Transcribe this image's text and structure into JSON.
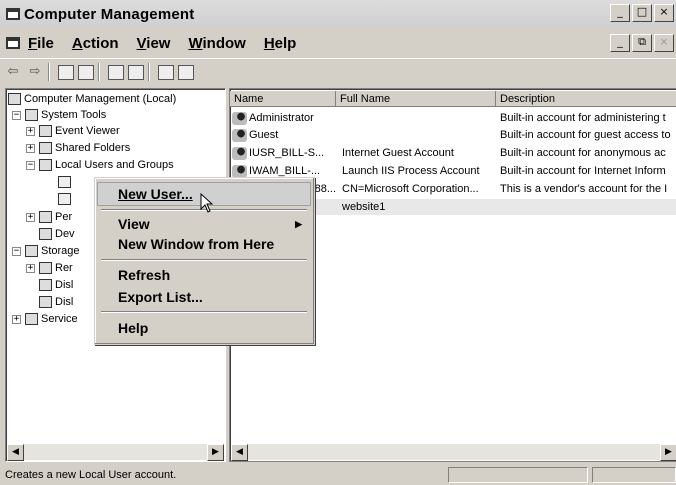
{
  "window": {
    "title": "Computer Management",
    "buttons": [
      "_",
      "□",
      "×"
    ],
    "mdi_buttons": [
      "_",
      "⧉",
      "×"
    ]
  },
  "menubar": {
    "items": [
      {
        "u": "F",
        "rest": "ile"
      },
      {
        "u": "A",
        "rest": "ction"
      },
      {
        "u": "V",
        "rest": "iew"
      },
      {
        "u": "W",
        "rest": "indow"
      },
      {
        "u": "H",
        "rest": "elp"
      }
    ]
  },
  "toolbar": {
    "back": "⇦",
    "forward": "⇨"
  },
  "tree": {
    "root": "Computer Management (Local)",
    "system_tools": "System Tools",
    "event_viewer": "Event Viewer",
    "shared_folders": "Shared Folders",
    "local_users_groups": "Local Users and Groups",
    "performance": "Per",
    "device_manager": "Dev",
    "storage": "Storage",
    "removable": "Rer",
    "disk_defrag": "Disl",
    "disk_mgmt": "Disl",
    "services": "Service"
  },
  "list": {
    "headers": [
      "Name",
      "Full Name",
      "Description"
    ],
    "rows": [
      {
        "name": "Administrator",
        "full": "",
        "desc": "Built-in account for administering t"
      },
      {
        "name": "Guest",
        "full": "",
        "desc": "Built-in account for guest access to"
      },
      {
        "name": "IUSR_BILL-S...",
        "full": "Internet Guest Account",
        "desc": "Built-in account for anonymous ac"
      },
      {
        "name": "IWAM_BILL-...",
        "full": "Launch IIS Process Account",
        "desc": "Built-in account for Internet Inform"
      },
      {
        "name": "...88...",
        "full": "CN=Microsoft Corporation...",
        "desc": "This is a vendor's account for the I"
      },
      {
        "name": "",
        "full": "website1",
        "desc": ""
      }
    ]
  },
  "context_menu": {
    "new_user": "New User...",
    "view": "View",
    "new_window": "New Window from Here",
    "refresh": "Refresh",
    "export_list": "Export List...",
    "help": "Help"
  },
  "status": {
    "text": "Creates a new Local User account."
  }
}
